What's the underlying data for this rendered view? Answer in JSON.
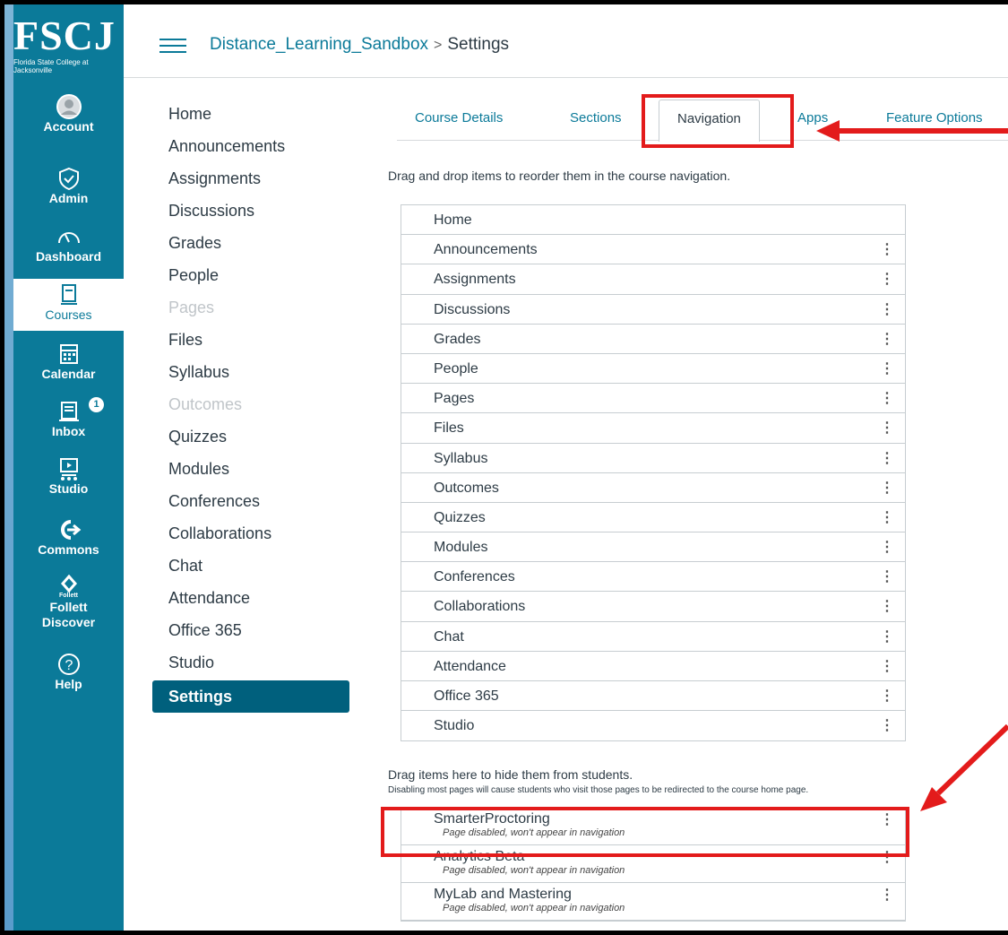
{
  "logo": {
    "text": "FSCJ",
    "subtext": "Florida State College at Jacksonville"
  },
  "global_nav": [
    {
      "label": "Account",
      "icon": "account-icon"
    },
    {
      "label": "Admin",
      "icon": "admin-icon"
    },
    {
      "label": "Dashboard",
      "icon": "dashboard-icon"
    },
    {
      "label": "Courses",
      "icon": "courses-icon"
    },
    {
      "label": "Calendar",
      "icon": "calendar-icon"
    },
    {
      "label": "Inbox",
      "icon": "inbox-icon",
      "badge": "1"
    },
    {
      "label": "Studio",
      "icon": "studio-icon"
    },
    {
      "label": "Commons",
      "icon": "commons-icon"
    },
    {
      "label": "Follett Discover",
      "icon": "follett-icon",
      "icon_text": "Follett"
    },
    {
      "label": "Help",
      "icon": "help-icon"
    }
  ],
  "breadcrumb": {
    "course": "Distance_Learning_Sandbox",
    "separator": ">",
    "page": "Settings"
  },
  "course_nav": [
    "Home",
    "Announcements",
    "Assignments",
    "Discussions",
    "Grades",
    "People",
    "Pages",
    "Files",
    "Syllabus",
    "Outcomes",
    "Quizzes",
    "Modules",
    "Conferences",
    "Collaborations",
    "Chat",
    "Attendance",
    "Office 365",
    "Studio",
    "Settings"
  ],
  "tabs": [
    "Course Details",
    "Sections",
    "Navigation",
    "Apps",
    "Feature Options"
  ],
  "hint_reorder": "Drag and drop items to reorder them in the course navigation.",
  "nav_items": [
    "Home",
    "Announcements",
    "Assignments",
    "Discussions",
    "Grades",
    "People",
    "Pages",
    "Files",
    "Syllabus",
    "Outcomes",
    "Quizzes",
    "Modules",
    "Conferences",
    "Collaborations",
    "Chat",
    "Attendance",
    "Office 365",
    "Studio"
  ],
  "hint_hide": "Drag items here to hide them from students.",
  "hint_disable": "Disabling most pages will cause students who visit those pages to be redirected to the course home page.",
  "hidden_items": [
    {
      "title": "SmarterProctoring",
      "status": "Page disabled, won't appear in navigation"
    },
    {
      "title": "Analytics Beta",
      "status": "Page disabled, won't appear in navigation"
    },
    {
      "title": "MyLab and Mastering",
      "status": "Page disabled, won't appear in navigation"
    }
  ],
  "kebab_glyph": "⋮",
  "colors": {
    "brand": "#0b7a99",
    "settings_active": "#00607d",
    "annotation": "#e31b1b"
  }
}
